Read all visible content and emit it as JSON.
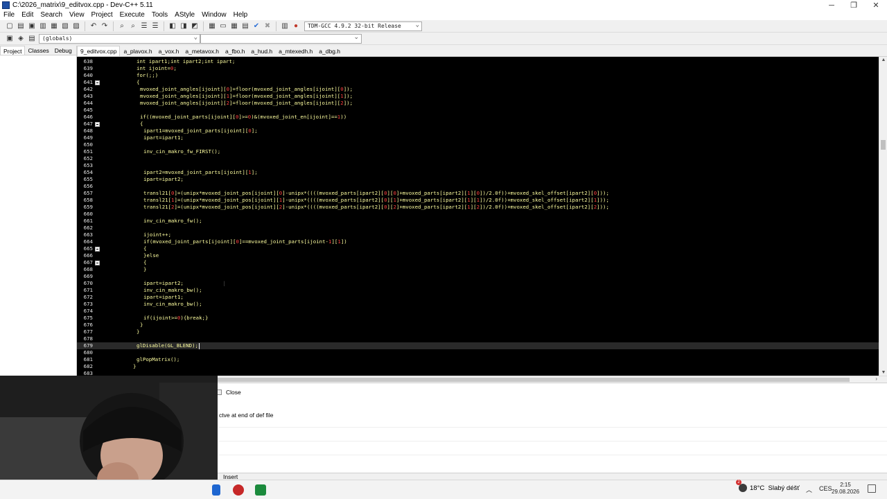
{
  "window": {
    "title": "C:\\2026_matrix\\9_editvox.cpp - Dev-C++ 5.11"
  },
  "menu": [
    "File",
    "Edit",
    "Search",
    "View",
    "Project",
    "Execute",
    "Tools",
    "AStyle",
    "Window",
    "Help"
  ],
  "toolbar": {
    "compiler": "TDM-GCC 4.9.2 32-bit Release",
    "globals": "(globals)"
  },
  "left_tabs": [
    "Project",
    "Classes",
    "Debug"
  ],
  "file_tabs": [
    "9_editvox.cpp",
    "a_plavox.h",
    "a_vox.h",
    "a_metavox.h",
    "a_fbo.h",
    "a_hud.h",
    "a_mtexedh.h",
    "a_dbg.h"
  ],
  "code_lines": [
    {
      "n": "638",
      "t": "int ipart1;int ipart2;int ipart;",
      "indent": 0
    },
    {
      "n": "639",
      "t": "int ijoint=0;",
      "indent": 0
    },
    {
      "n": "640",
      "t": "for(;;)",
      "indent": 0
    },
    {
      "n": "641",
      "t": "{",
      "indent": 0,
      "fold": true
    },
    {
      "n": "642",
      "t": "mvoxed_joint_angles[ijoint][0]=floor(mvoxed_joint_angles[ijoint][0]);",
      "indent": 1
    },
    {
      "n": "643",
      "t": "mvoxed_joint_angles[ijoint][1]=floor(mvoxed_joint_angles[ijoint][1]);",
      "indent": 1
    },
    {
      "n": "644",
      "t": "mvoxed_joint_angles[ijoint][2]=floor(mvoxed_joint_angles[ijoint][2]);",
      "indent": 1
    },
    {
      "n": "645",
      "t": "",
      "indent": 0
    },
    {
      "n": "646",
      "t": "if((mvoxed_joint_parts[ijoint][0]>=0)&(mvoxed_joint_en[ijoint]==1))",
      "indent": 1
    },
    {
      "n": "647",
      "t": "{",
      "indent": 1,
      "fold": true
    },
    {
      "n": "648",
      "t": "ipart1=mvoxed_joint_parts[ijoint][0];",
      "indent": 2
    },
    {
      "n": "649",
      "t": "ipart=ipart1;",
      "indent": 2
    },
    {
      "n": "650",
      "t": "",
      "indent": 0
    },
    {
      "n": "651",
      "t": "inv_cin_makro_fw_FIRST();",
      "indent": 2
    },
    {
      "n": "652",
      "t": "",
      "indent": 0
    },
    {
      "n": "653",
      "t": "",
      "indent": 0
    },
    {
      "n": "654",
      "t": "ipart2=mvoxed_joint_parts[ijoint][1];",
      "indent": 2
    },
    {
      "n": "655",
      "t": "ipart=ipart2;",
      "indent": 2
    },
    {
      "n": "656",
      "t": "",
      "indent": 0
    },
    {
      "n": "657",
      "t": "transl21[0]=(unipx*mvoxed_joint_pos[ijoint][0]-unipx*((((mvoxed_parts[ipart2][0][0]+mvoxed_parts[ipart2][1][0])/2.0f))+mvoxed_skel_offset[ipart2][0]));",
      "indent": 2
    },
    {
      "n": "658",
      "t": "transl21[1]=(unipx*mvoxed_joint_pos[ijoint][1]-unipx*((((mvoxed_parts[ipart2][0][1]+mvoxed_parts[ipart2][1][1])/2.0f))+mvoxed_skel_offset[ipart2][1]));",
      "indent": 2
    },
    {
      "n": "659",
      "t": "transl21[2]=(unipx*mvoxed_joint_pos[ijoint][2]-unipx*((((mvoxed_parts[ipart2][0][2]+mvoxed_parts[ipart2][1][2])/2.0f))+mvoxed_skel_offset[ipart2][2]));",
      "indent": 2
    },
    {
      "n": "660",
      "t": "",
      "indent": 0
    },
    {
      "n": "661",
      "t": "inv_cin_makro_fw();",
      "indent": 2
    },
    {
      "n": "662",
      "t": "",
      "indent": 0
    },
    {
      "n": "663",
      "t": "ijoint++;",
      "indent": 2
    },
    {
      "n": "664",
      "t": "if(mvoxed_joint_parts[ijoint][0]==mvoxed_joint_parts[ijoint-1][1])",
      "indent": 2
    },
    {
      "n": "665",
      "t": "{",
      "indent": 2,
      "fold": true
    },
    {
      "n": "666",
      "t": "}else",
      "indent": 2
    },
    {
      "n": "667",
      "t": "{",
      "indent": 2,
      "fold": true
    },
    {
      "n": "668",
      "t": "}",
      "indent": 2
    },
    {
      "n": "669",
      "t": "",
      "indent": 0
    },
    {
      "n": "670",
      "t": "ipart=ipart2;",
      "indent": 2
    },
    {
      "n": "671",
      "t": "inv_cin_makro_bw();",
      "indent": 2
    },
    {
      "n": "672",
      "t": "ipart=ipart1;",
      "indent": 2
    },
    {
      "n": "673",
      "t": "inv_cin_makro_bw();",
      "indent": 2
    },
    {
      "n": "674",
      "t": "",
      "indent": 0
    },
    {
      "n": "675",
      "t": "if(ijoint>=0){break;}",
      "indent": 2
    },
    {
      "n": "676",
      "t": "}",
      "indent": 1
    },
    {
      "n": "677",
      "t": "}",
      "indent": 0
    },
    {
      "n": "678",
      "t": "",
      "indent": 0
    },
    {
      "n": "679",
      "t": "glDisable(GL_BLEND);",
      "indent": 0,
      "current": true
    },
    {
      "n": "680",
      "t": "",
      "indent": 0
    },
    {
      "n": "681",
      "t": "glPopMatrix();",
      "indent": 0
    },
    {
      "n": "682",
      "t": "}",
      "indent": -1
    },
    {
      "n": "683",
      "t": "",
      "indent": 0
    }
  ],
  "bottom": {
    "close_label": "Close",
    "message": "ctve at end of def file"
  },
  "status": {
    "mode": "Insert"
  },
  "taskbar": {
    "weather_temp": "18°C",
    "weather_text": "Slabý déšť",
    "weather_badge": "2",
    "lang": "CES",
    "time": "2:15",
    "date": "29.08.2026"
  },
  "colors": {
    "editor_bg": "#000000",
    "code_text": "#ffffa0",
    "number": "#ff4040",
    "line_numbers": "#e8e8e8"
  }
}
